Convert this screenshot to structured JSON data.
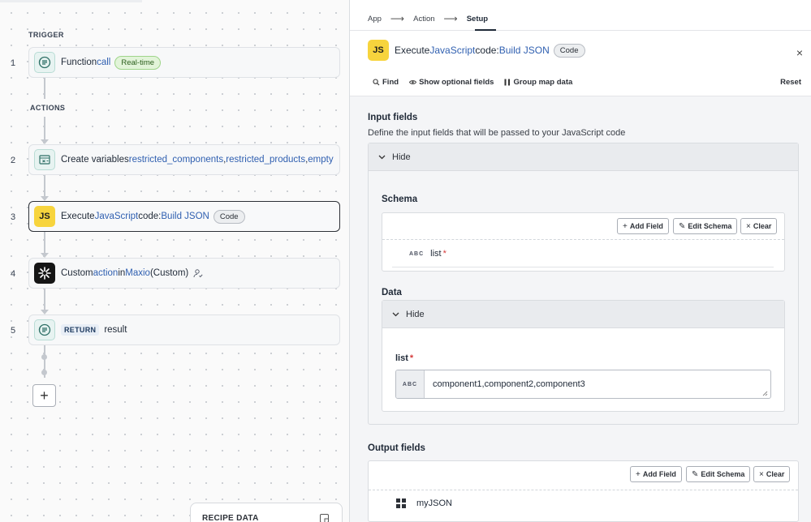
{
  "canvas": {
    "trigger_label": "TRIGGER",
    "actions_label": "ACTIONS",
    "steps": [
      {
        "num": "1",
        "parts": [
          "Function ",
          "call"
        ],
        "pill": "Real-time"
      },
      {
        "num": "2",
        "parts": [
          "Create variables ",
          "restricted_components",
          ", ",
          "restricted_products",
          ", ",
          "empty"
        ]
      },
      {
        "num": "3",
        "parts": [
          "Execute ",
          "JavaScript",
          " code: ",
          "Build JSON"
        ],
        "pill": "Code",
        "icon_text": "JS"
      },
      {
        "num": "4",
        "parts": [
          "Custom ",
          "action",
          " in ",
          "Maxio",
          " (Custom)"
        ]
      },
      {
        "num": "5",
        "return_tag": "RETURN",
        "text": "result"
      }
    ],
    "add_icon": "+",
    "recipe_data_label": "RECIPE DATA"
  },
  "panel": {
    "breadcrumb": [
      "App",
      "Action",
      "Setup"
    ],
    "breadcrumb_sep": "⟶",
    "title_icon_text": "JS",
    "title_parts": [
      "Execute ",
      "JavaScript",
      " code: ",
      "Build JSON"
    ],
    "title_pill": "Code",
    "close": "×",
    "toolbar": {
      "find": "Find",
      "optional": "Show optional fields",
      "group": "Group map data",
      "reset": "Reset"
    },
    "input_fields": {
      "title": "Input fields",
      "desc": "Define the input fields that will be passed to your JavaScript code",
      "hide": "Hide",
      "schema": {
        "title": "Schema",
        "add_field": "Add Field",
        "edit_schema": "Edit Schema",
        "clear": "Clear",
        "field_type": "ABC",
        "field_name": "list",
        "required": "*"
      },
      "data": {
        "title": "Data",
        "hide": "Hide",
        "field_label": "list",
        "required": "*",
        "field_type": "ABC",
        "value": "component1,component2,component3"
      }
    },
    "output_fields": {
      "title": "Output fields",
      "add_field": "Add Field",
      "edit_schema": "Edit Schema",
      "clear": "Clear",
      "field_name": "myJSON"
    }
  }
}
